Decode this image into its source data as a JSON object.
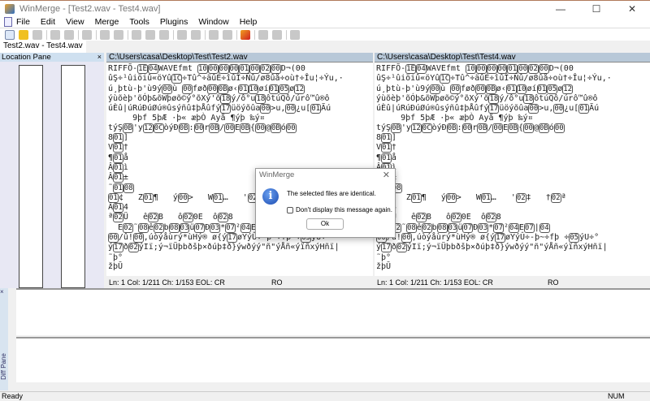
{
  "window": {
    "title": "WinMerge - [Test2.wav - Test4.wav]",
    "controls": [
      "—",
      "☐",
      "✕"
    ]
  },
  "menu": [
    "File",
    "Edit",
    "View",
    "Merge",
    "Tools",
    "Plugins",
    "Window",
    "Help"
  ],
  "tab": "Test2.wav - Test4.wav",
  "location_pane": {
    "title": "Location Pane",
    "close": "×"
  },
  "left": {
    "path": "C:\\Users\\casa\\Desktop\\Test\\Test2.wav",
    "status": {
      "pos": "Ln: 1  Col: 1/211  Ch: 1/153  EOL: CR",
      "mode": "RO"
    }
  },
  "right": {
    "path": "C:\\Users\\casa\\Desktop\\Test\\Test4.wav",
    "status": {
      "pos": "Ln: 1  Col: 1/211  Ch: 1/153  EOL: CR",
      "mode": "RO"
    }
  },
  "content_lines": [
    "RIFFÕ-(1E)(04)WAVEfmt (10)(00)(00)(00)(01)(00)(02)(00)D¬(00",
    "ûŞ÷¹ûiöiû«öYû(1C)÷Tû^÷äûÉ÷îûÎ÷Ñû/ø8ûå÷où†÷Îu¦÷Ýu,·",
    "ú¸þtù-þ'ù9ý(00)ù (00)føð(00)(0B)ø‹(01)(10)øí(01)(05)ø(12)",
    "ýùõèþ'õÓþ&õWþøõ©ý°õXý'õ(18)ý/ô°u(18)ôtúQô/úrô™û®ô",
    "úÈû|úRúÐúØú®ûsýñû‡þÅûfý(17)üöýõûa(00)>u,(00)¿u[(01)Ãú",
    "     9þf 5þÆ ·þ« æþÒ Ayå ¶ýþ ‰ý¤",
    "týŞ(0B)'y(12)(0C)òýÐ(0B):(00)r(0B)/(00)E(0B){(00)@(0B)ó(00)",
    "8(01)]",
    "V(01)†",
    "¶(01)å",
    "Â(01)ì",
    "Â(01)±",
    "˜(01)(08)",
    "(01)¢   Z(01)¶   ý(00)>   W(01)…   '(02)‡   †(02)ª",
    "Â(01)4",
    "ª(02)Ü   ê(02)B   ô(02)0E  ô(02)8",
    "  E(02)˜(08)ê(02)b(08)(03)ü(07)Ð(03)*(07)²(04)E(07)|(04)",
    "(00)/û!(00),úòýåùrý*ùHý® ø{ý(17)øYýÛ÷-þ~÷fþ ÷(05)ýU÷°",
    "ý(17)ð(02)ýIï;ý¬ïÜþbðšþ×ðúþ‡ð}ýwðýý\"ñ\"ýÅñ«ýïñxýHñï|",
    "˜þ°",
    "žþŪ"
  ],
  "diff_pane": {
    "title": "Diff Pane",
    "close": "×"
  },
  "statusbar": {
    "text": "Ready",
    "num": "NUM"
  },
  "dialog": {
    "title": "WinMerge",
    "close": "✕",
    "message": "The selected files are identical.",
    "checkbox": "Don't display this message again.",
    "checkbox_checked": false,
    "ok": "Ok",
    "icon": "info-icon"
  }
}
